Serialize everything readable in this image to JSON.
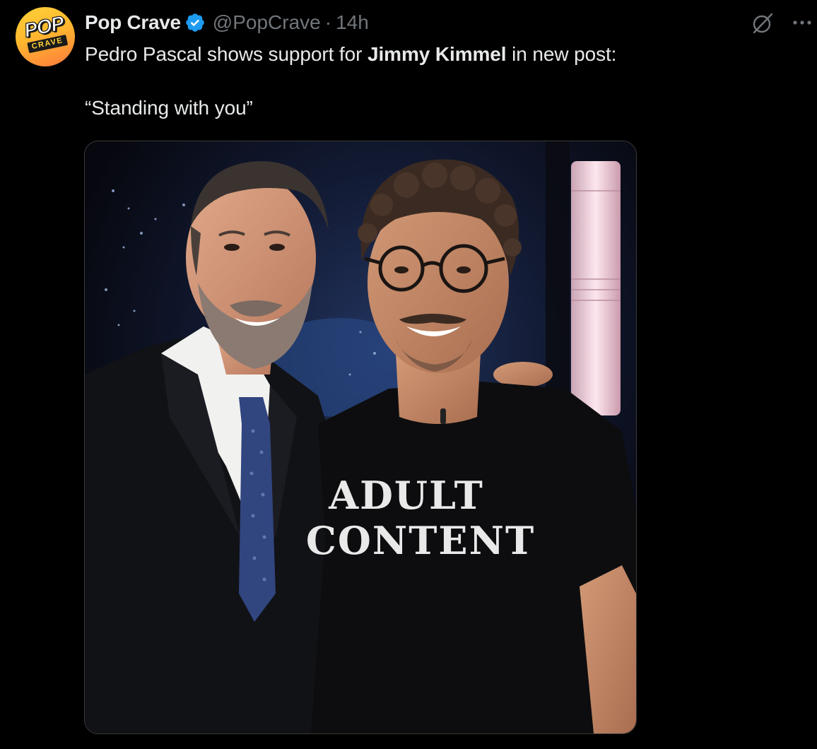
{
  "author": {
    "display_name": "Pop Crave",
    "handle": "@PopCrave",
    "timestamp": "14h",
    "separator": "·",
    "verified": true,
    "avatar_text_top": "POP",
    "avatar_text_bottom": "CRAVE"
  },
  "tweet": {
    "text_before": "Pedro Pascal shows support for ",
    "text_bold": "Jimmy Kimmel",
    "text_after": " in new post:",
    "quote": "“Standing with you”"
  },
  "media": {
    "shirt_line_1": "ADULT",
    "shirt_line_2": "CONTENT"
  },
  "icons": {
    "verified": "verified-badge-icon",
    "grok": "grok-icon",
    "more": "more-options-icon"
  },
  "colors": {
    "background": "#000000",
    "text_primary": "#e7e9ea",
    "text_secondary": "#71767b",
    "verified_blue": "#1d9bf0",
    "avatar_yellow": "#ffd23a",
    "avatar_orange": "#ff7a3d"
  }
}
